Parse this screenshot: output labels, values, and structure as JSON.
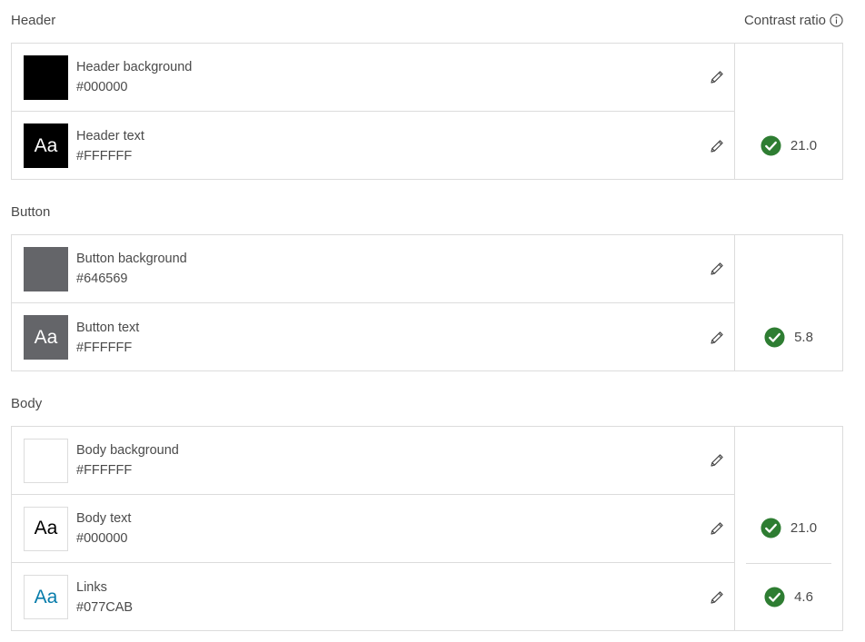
{
  "contrast_header": "Contrast ratio",
  "groups": [
    {
      "title": "Header",
      "rows": [
        {
          "name": "Header background",
          "hex": "#000000",
          "swatch_text": ""
        },
        {
          "name": "Header text",
          "hex": "#FFFFFF",
          "swatch_text": "Aa"
        }
      ],
      "ratios": [
        "21.0"
      ]
    },
    {
      "title": "Button",
      "rows": [
        {
          "name": "Button background",
          "hex": "#646569",
          "swatch_text": ""
        },
        {
          "name": "Button text",
          "hex": "#FFFFFF",
          "swatch_text": "Aa"
        }
      ],
      "ratios": [
        "5.8"
      ]
    },
    {
      "title": "Body",
      "rows": [
        {
          "name": "Body background",
          "hex": "#FFFFFF",
          "swatch_text": ""
        },
        {
          "name": "Body text",
          "hex": "#000000",
          "swatch_text": "Aa"
        },
        {
          "name": "Links",
          "hex": "#077CAB",
          "swatch_text": "Aa"
        }
      ],
      "ratios": [
        "21.0",
        "4.6"
      ]
    }
  ],
  "colors": {
    "check_green": "#2e7d32",
    "border": "#dcdcdc",
    "header_bg": "#000000",
    "button_bg": "#646569",
    "body_bg": "#FFFFFF",
    "link": "#077CAB"
  }
}
